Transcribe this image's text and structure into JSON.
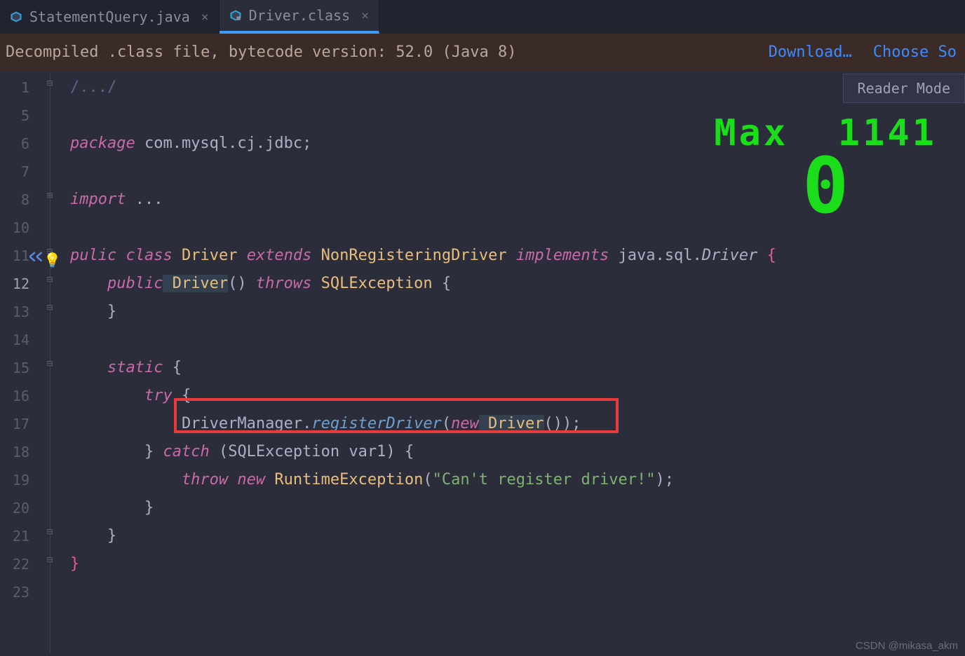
{
  "tabs": [
    {
      "label": "StatementQuery.java",
      "active": false
    },
    {
      "label": "Driver.class",
      "active": true
    }
  ],
  "banner": {
    "text": "Decompiled .class file, bytecode version: 52.0 (Java 8)",
    "download": "Download…",
    "choose": "Choose So"
  },
  "reader_mode": "Reader Mode",
  "gutter_lines": [
    "1",
    "5",
    "6",
    "7",
    "8",
    "10",
    "11",
    "12",
    "13",
    "14",
    "15",
    "16",
    "17",
    "18",
    "19",
    "20",
    "21",
    "22",
    "23"
  ],
  "gutter_current": "12",
  "code": {
    "l1": "/.../",
    "l3_pkg": "package",
    "l3_nm": " com.mysql.cj.jdbc;",
    "l5_imp": "import",
    "l5_rest": " ...",
    "l7_pub": "pu",
    "l7_lic": "lic",
    "l7_class": " class",
    "l7_driver": " Driver",
    "l7_ext": " extends",
    "l7_nrd": " NonRegisteringDriver",
    "l7_impl": " implements",
    "l7_jsd_pre": " java.sql.",
    "l7_jsd": "Driver",
    "l7_brace": " {",
    "l8_pub": "    public",
    "l8_drv": " Driver",
    "l8_paren": "()",
    "l8_throws": " throws",
    "l8_sqlexc": " SQLException",
    "l8_brace": " {",
    "l9": "    }",
    "l11_static": "    static",
    "l11_brace": " {",
    "l12_try": "        try",
    "l12_brace": " {",
    "l13_dm": "            DriverManager.",
    "l13_reg": "registerDriver",
    "l13_lp": "(",
    "l13_new": "new",
    "l13_drv": " Driver",
    "l13_rp": "());",
    "l14_lp": "        }",
    "l14_catch": " catch",
    "l14_rp": " (SQLException var1) {",
    "l15_throw": "            throw",
    "l15_new": " new",
    "l15_rte": " RuntimeException",
    "l15_lp": "(",
    "l15_str": "\"Can't register driver!\"",
    "l15_rp": ");",
    "l16": "        }",
    "l17": "    }",
    "l18": "}"
  },
  "overlay": {
    "label": "Max",
    "value": "1141",
    "big": "0"
  },
  "watermark": "CSDN @mikasa_akm"
}
